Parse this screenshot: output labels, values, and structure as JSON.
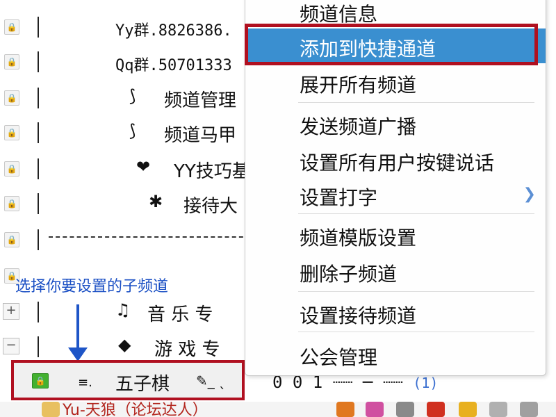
{
  "channels": [
    {
      "text": "Yy群.8826386.",
      "icon": "",
      "mono": true
    },
    {
      "text": "Qq群.50701333",
      "icon": "",
      "mono": true
    },
    {
      "text": "频道管理",
      "icon": "⟆"
    },
    {
      "text": "频道马甲",
      "icon": "⟆"
    },
    {
      "text": "YY技巧基",
      "icon": "❤"
    },
    {
      "text": "接待大",
      "icon": "✱"
    }
  ],
  "hint": "选择你要设置的子频道",
  "groups": [
    {
      "toggle": "+",
      "icon": "♫",
      "text": "音 乐 专"
    },
    {
      "toggle": "−",
      "icon": "◆",
      "text": "游 戏 专"
    }
  ],
  "selected": {
    "marker": "≡.",
    "name": "五子棋",
    "tag": "✎_ ˎ",
    "number": "0 0 1 ┈┈ ─ ┈┈",
    "count": "(1)"
  },
  "status": {
    "text": "Yu-天狼（论坛达人）"
  },
  "menu": {
    "items": [
      {
        "label": "频道信息"
      },
      {
        "label": "添加到快捷通道",
        "highlighted": true
      },
      {
        "label": "展开所有频道"
      },
      {
        "label": "发送频道广播"
      },
      {
        "label": "设置所有用户按键说话"
      },
      {
        "label": "设置打字",
        "submenu": true
      },
      {
        "label": "频道模版设置"
      },
      {
        "label": "删除子频道"
      },
      {
        "label": "设置接待频道"
      },
      {
        "label": "公会管理"
      }
    ]
  },
  "colors": {
    "highlight": "#3a8fd0",
    "annotation_red": "#b01020",
    "hint_blue": "#1a4fc4"
  }
}
